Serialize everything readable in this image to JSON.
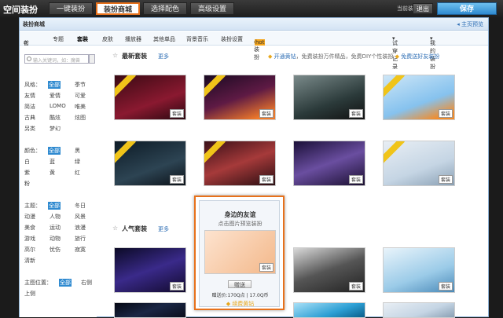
{
  "topbar": {
    "title": "空间装扮",
    "tabs": [
      "一键装扮",
      "装扮商城",
      "选择配色",
      "高级设置"
    ],
    "current_label": "当前装扮",
    "exit_label": "退出",
    "save_label": "保存"
  },
  "panel": {
    "title": "装扮商城",
    "home_preview": "主页预览"
  },
  "nav": {
    "items": [
      "首页",
      "专题",
      "套装",
      "皮肤",
      "播放器",
      "其他单品",
      "背景音乐",
      "装扮设置",
      "6.0装扮"
    ],
    "hot_badge": "hot",
    "right": [
      "试穿记录",
      "我的装扮"
    ]
  },
  "sidebar": {
    "search_placeholder": "输入关键词，如：魔兽",
    "style_label": "风格：",
    "style_all": "全部",
    "styles": [
      "季节",
      "友情",
      "爱情",
      "可爱",
      "简洁",
      "LOMO",
      "唯美",
      "古典",
      "酷炫",
      "炫图",
      "另类",
      "梦幻"
    ],
    "color_label": "颜色：",
    "color_all": "全部",
    "colors": [
      "黑",
      "白",
      "蓝",
      "绿",
      "紫",
      "黄",
      "红",
      "粉"
    ],
    "theme_label": "主题：",
    "theme_all": "全部",
    "themes": [
      "冬日",
      "动漫",
      "人物",
      "风景",
      "美食",
      "运动",
      "浪漫",
      "游戏",
      "动物",
      "旅行",
      "高尔",
      "忧伤",
      "寂寞",
      "清新"
    ],
    "position_label": "主图位置：",
    "position_all": "全部",
    "positions": [
      "右侧",
      "上侧"
    ]
  },
  "main": {
    "section1_title": "最新套装",
    "section1_more": "更多",
    "promo_link": "开通黄钻",
    "promo_text": "，免费装扮万件精品，免费DIY个性装扮",
    "promo_buy": "免费送好友装扮",
    "section2_title": "人气套装",
    "section2_more": "更多",
    "tag_label": "套装",
    "ribbon_label": "黄钻专享"
  },
  "popup": {
    "title": "身边的友谊",
    "subtitle": "点击图片预览装扮",
    "img_tag": "套装",
    "gift_label": "赠送",
    "price": "赠送价:170Q点 | 17.0Q币",
    "buy": "续费黄钻"
  }
}
